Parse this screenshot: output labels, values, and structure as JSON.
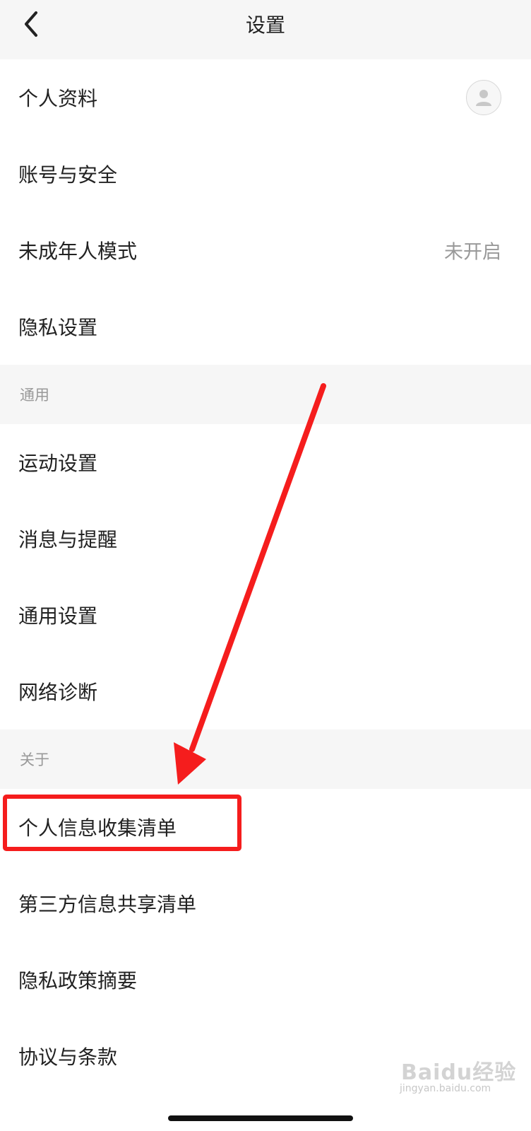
{
  "header": {
    "title": "设置"
  },
  "account_items": [
    {
      "label": "个人资料"
    },
    {
      "label": "账号与安全"
    },
    {
      "label": "未成年人模式",
      "value": "未开启"
    },
    {
      "label": "隐私设置"
    }
  ],
  "sections": {
    "general": {
      "label": "通用",
      "items": [
        {
          "label": "运动设置"
        },
        {
          "label": "消息与提醒"
        },
        {
          "label": "通用设置"
        },
        {
          "label": "网络诊断"
        }
      ]
    },
    "about": {
      "label": "关于",
      "items": [
        {
          "label": "个人信息收集清单"
        },
        {
          "label": "第三方信息共享清单"
        },
        {
          "label": "隐私政策摘要"
        },
        {
          "label": "协议与条款"
        }
      ]
    }
  },
  "icons": {
    "back": "chevron-left-icon",
    "avatar": "user-avatar-icon"
  },
  "annotation": {
    "arrow_color": "#f51d1d",
    "box_color": "#f51d1d"
  },
  "watermark": {
    "main": "Baidu经验",
    "sub": "jingyan.baidu.com"
  }
}
